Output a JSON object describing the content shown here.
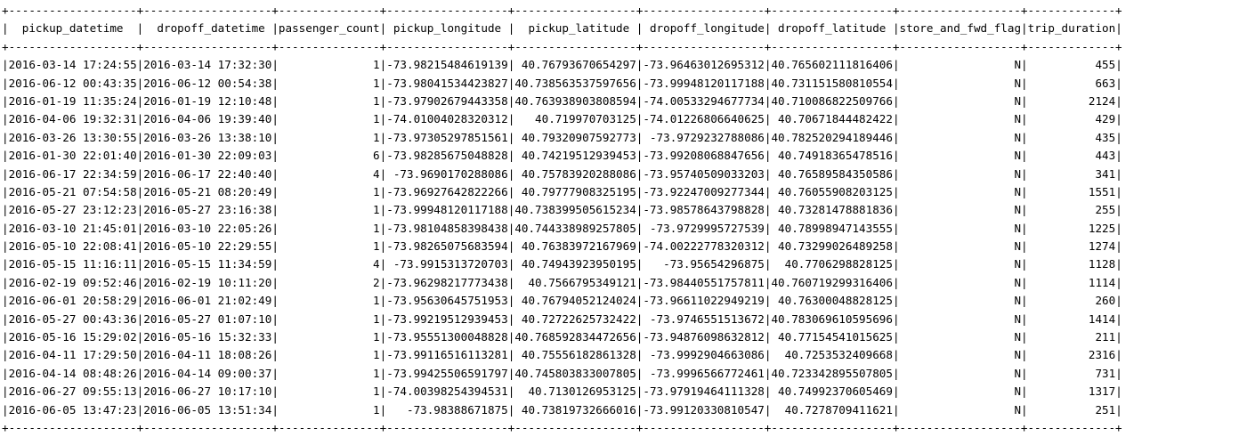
{
  "table": {
    "columns": [
      "pickup_datetime",
      "dropoff_datetime",
      "passenger_count",
      "pickup_longitude",
      "pickup_latitude",
      "dropoff_longitude",
      "dropoff_latitude",
      "store_and_fwd_flag",
      "trip_duration"
    ],
    "rows": [
      [
        "2016-03-14 17:24:55",
        "2016-03-14 17:32:30",
        "1",
        "-73.98215484619139",
        "40.76793670654297",
        "-73.96463012695312",
        "40.765602111816406",
        "N",
        "455"
      ],
      [
        "2016-06-12 00:43:35",
        "2016-06-12 00:54:38",
        "1",
        "-73.98041534423827",
        "40.738563537597656",
        "-73.99948120117188",
        "40.731151580810554",
        "N",
        "663"
      ],
      [
        "2016-01-19 11:35:24",
        "2016-01-19 12:10:48",
        "1",
        "-73.97902679443358",
        "40.763938903808594",
        "-74.00533294677734",
        "40.710086822509766",
        "N",
        "2124"
      ],
      [
        "2016-04-06 19:32:31",
        "2016-04-06 19:39:40",
        "1",
        "-74.01004028320312",
        "40.719970703125",
        "-74.01226806640625",
        "40.70671844482422",
        "N",
        "429"
      ],
      [
        "2016-03-26 13:30:55",
        "2016-03-26 13:38:10",
        "1",
        "-73.97305297851561",
        "40.79320907592773",
        "-73.9729232788086",
        "40.782520294189446",
        "N",
        "435"
      ],
      [
        "2016-01-30 22:01:40",
        "2016-01-30 22:09:03",
        "6",
        "-73.98285675048828",
        "40.74219512939453",
        "-73.99208068847656",
        "40.74918365478516",
        "N",
        "443"
      ],
      [
        "2016-06-17 22:34:59",
        "2016-06-17 22:40:40",
        "4",
        "-73.9690170288086",
        "40.75783920288086",
        "-73.95740509033203",
        "40.76589584350586",
        "N",
        "341"
      ],
      [
        "2016-05-21 07:54:58",
        "2016-05-21 08:20:49",
        "1",
        "-73.96927642822266",
        "40.79777908325195",
        "-73.92247009277344",
        "40.76055908203125",
        "N",
        "1551"
      ],
      [
        "2016-05-27 23:12:23",
        "2016-05-27 23:16:38",
        "1",
        "-73.99948120117188",
        "40.738399505615234",
        "-73.98578643798828",
        "40.73281478881836",
        "N",
        "255"
      ],
      [
        "2016-03-10 21:45:01",
        "2016-03-10 22:05:26",
        "1",
        "-73.98104858398438",
        "40.744338989257805",
        "-73.9729995727539",
        "40.78998947143555",
        "N",
        "1225"
      ],
      [
        "2016-05-10 22:08:41",
        "2016-05-10 22:29:55",
        "1",
        "-73.98265075683594",
        "40.76383972167969",
        "-74.00222778320312",
        "40.73299026489258",
        "N",
        "1274"
      ],
      [
        "2016-05-15 11:16:11",
        "2016-05-15 11:34:59",
        "4",
        "-73.9915313720703",
        "40.74943923950195",
        "-73.95654296875",
        "40.7706298828125",
        "N",
        "1128"
      ],
      [
        "2016-02-19 09:52:46",
        "2016-02-19 10:11:20",
        "2",
        "-73.96298217773438",
        "40.7566795349121",
        "-73.98440551757811",
        "40.760719299316406",
        "N",
        "1114"
      ],
      [
        "2016-06-01 20:58:29",
        "2016-06-01 21:02:49",
        "1",
        "-73.95630645751953",
        "40.76794052124024",
        "-73.96611022949219",
        "40.76300048828125",
        "N",
        "260"
      ],
      [
        "2016-05-27 00:43:36",
        "2016-05-27 01:07:10",
        "1",
        "-73.99219512939453",
        "40.72722625732422",
        "-73.9746551513672",
        "40.783069610595696",
        "N",
        "1414"
      ],
      [
        "2016-05-16 15:29:02",
        "2016-05-16 15:32:33",
        "1",
        "-73.95551300048828",
        "40.768592834472656",
        "-73.94876098632812",
        "40.77154541015625",
        "N",
        "211"
      ],
      [
        "2016-04-11 17:29:50",
        "2016-04-11 18:08:26",
        "1",
        "-73.99116516113281",
        "40.75556182861328",
        "-73.9992904663086",
        "40.7253532409668",
        "N",
        "2316"
      ],
      [
        "2016-04-14 08:48:26",
        "2016-04-14 09:00:37",
        "1",
        "-73.99425506591797",
        "40.745803833007805",
        "-73.9996566772461",
        "40.723342895507805",
        "N",
        "731"
      ],
      [
        "2016-06-27 09:55:13",
        "2016-06-27 10:17:10",
        "1",
        "-74.00398254394531",
        "40.7130126953125",
        "-73.97919464111328",
        "40.74992370605469",
        "N",
        "1317"
      ],
      [
        "2016-06-05 13:47:23",
        "2016-06-05 13:51:34",
        "1",
        "-73.98388671875",
        "40.73819732666016",
        "-73.99120330810547",
        "40.7278709411621",
        "N",
        "251"
      ]
    ]
  }
}
